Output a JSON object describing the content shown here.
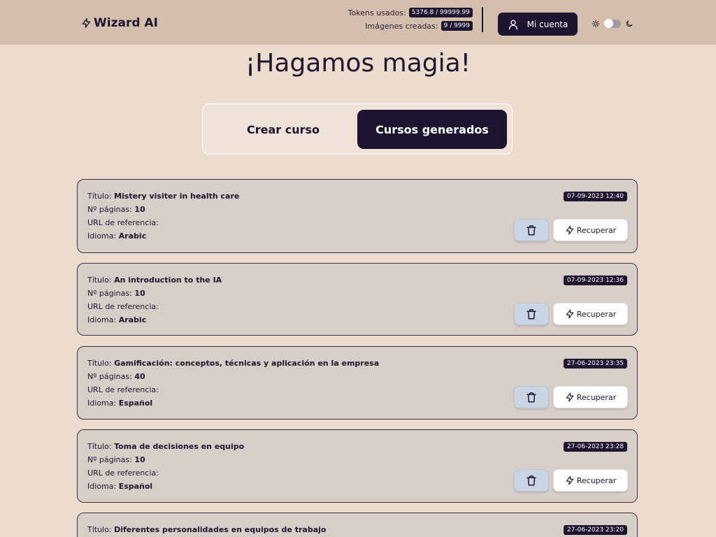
{
  "header": {
    "brand": "Wizard AI",
    "tokens_label": "Tokens usados:",
    "tokens_value": "5376.8 / 99999.99",
    "images_label": "Imágenes creadas:",
    "images_value": "9 / 9999",
    "account_label": "Mi cuenta",
    "theme_dark": false
  },
  "page": {
    "title": "¡Hagamos magia!"
  },
  "tabs": {
    "create": "Crear curso",
    "generated": "Cursos generados",
    "active": "generated"
  },
  "labels": {
    "title": "Título:",
    "pages": "Nº páginas:",
    "url": "URL de referencia:",
    "language": "Idioma:",
    "recover": "Recuperar"
  },
  "courses": [
    {
      "title": "Mistery visiter in health care",
      "pages": "10",
      "url": "",
      "language": "Arabic",
      "date": "07-09-2023 12:40"
    },
    {
      "title": "An introduction to the IA",
      "pages": "10",
      "url": "",
      "language": "Arabic",
      "date": "07-09-2023 12:36"
    },
    {
      "title": "Gamificación: conceptos, técnicas y aplicación en la empresa",
      "pages": "40",
      "url": "",
      "language": "Español",
      "date": "27-06-2023 23:35"
    },
    {
      "title": "Toma de decisiones en equipo",
      "pages": "10",
      "url": "",
      "language": "Español",
      "date": "27-06-2023 23:28"
    },
    {
      "title": "Diferentes personalidades en equipos de trabajo",
      "pages": "",
      "url": "",
      "language": "",
      "date": "27-06-2023 23:20"
    }
  ],
  "colors": {
    "background": "#ecdccd",
    "header": "#d4bfac",
    "primary": "#1d1530",
    "card": "#d9cdc8",
    "trash_button": "#c8d5e2"
  },
  "icons": {
    "brand": "bolt-icon",
    "account": "user-icon",
    "light": "sun-icon",
    "dark": "moon-icon",
    "delete": "trash-icon",
    "recover": "bolt-icon"
  }
}
